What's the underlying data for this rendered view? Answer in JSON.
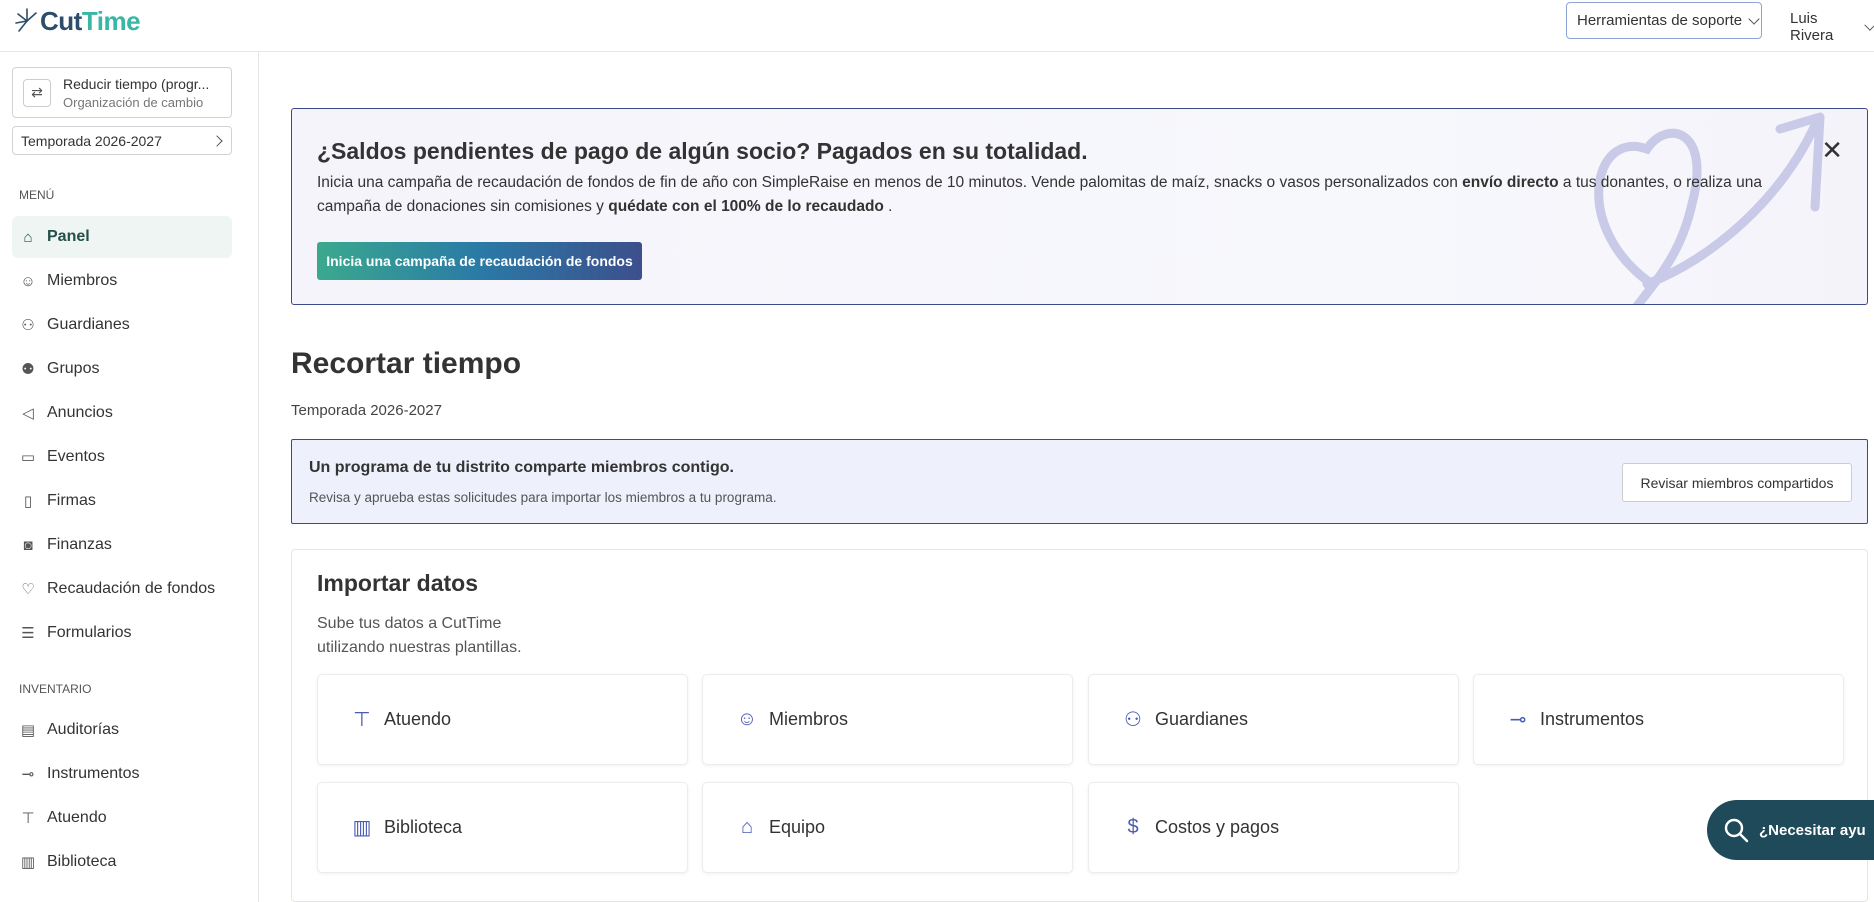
{
  "app": {
    "logo_cut": "Cut",
    "logo_time": "Time"
  },
  "header": {
    "support_tools": "Herramientas de soporte",
    "user_name": "Luis Rivera"
  },
  "sidebar": {
    "org_name": "Reducir tiempo (progr...",
    "org_type": "Organización de cambio",
    "season": "Temporada 2026-2027",
    "menu_label": "MENÚ",
    "menu_items": [
      {
        "label": "Panel",
        "icon": "home-icon"
      },
      {
        "label": "Miembros",
        "icon": "members-icon"
      },
      {
        "label": "Guardianes",
        "icon": "guardians-icon"
      },
      {
        "label": "Grupos",
        "icon": "groups-icon"
      },
      {
        "label": "Anuncios",
        "icon": "megaphone-icon"
      },
      {
        "label": "Eventos",
        "icon": "calendar-icon"
      },
      {
        "label": "Firmas",
        "icon": "document-icon"
      },
      {
        "label": "Finanzas",
        "icon": "finance-icon"
      },
      {
        "label": "Recaudación de fondos",
        "icon": "heart-icon"
      },
      {
        "label": "Formularios",
        "icon": "checklist-icon"
      }
    ],
    "inventory_label": "INVENTARIO",
    "inventory_items": [
      {
        "label": "Auditorías",
        "icon": "clipboard-icon"
      },
      {
        "label": "Instrumentos",
        "icon": "trumpet-icon"
      },
      {
        "label": "Atuendo",
        "icon": "shirt-icon"
      },
      {
        "label": "Biblioteca",
        "icon": "book-icon"
      }
    ]
  },
  "banner": {
    "title": "¿Saldos pendientes de pago de algún socio? Pagados en su totalidad.",
    "text_1": "Inicia una campaña de recaudación de fondos de fin de año con SimpleRaise en menos de 10 minutos. Vende palomitas de maíz, snacks o vasos personalizados con ",
    "text_bold_1": "envío directo",
    "text_2": " a tus donantes, o realiza una campaña de donaciones sin comisiones y ",
    "text_bold_2": "quédate con el 100% de lo recaudado",
    "text_3": " .",
    "cta": "Inicia una campaña de recaudación de fondos"
  },
  "page": {
    "title": "Recortar tiempo",
    "season": "Temporada 2026-2027"
  },
  "notice": {
    "title": "Un programa de tu distrito comparte miembros contigo.",
    "text": "Revisa y aprueba estas solicitudes para importar los miembros a tu programa.",
    "button": "Revisar miembros compartidos"
  },
  "import": {
    "title": "Importar datos",
    "description": "Sube tus datos a CutTime utilizando nuestras plantillas.",
    "tiles": [
      {
        "label": "Atuendo",
        "icon": "shirt-icon"
      },
      {
        "label": "Miembros",
        "icon": "members-icon"
      },
      {
        "label": "Guardianes",
        "icon": "guardians-icon"
      },
      {
        "label": "Instrumentos",
        "icon": "trumpet-icon"
      },
      {
        "label": "Biblioteca",
        "icon": "book-icon"
      },
      {
        "label": "Equipo",
        "icon": "equipment-icon"
      },
      {
        "label": "Costos y pagos",
        "icon": "dollar-icon"
      }
    ]
  },
  "help": {
    "label": "¿Necesitar ayu"
  }
}
